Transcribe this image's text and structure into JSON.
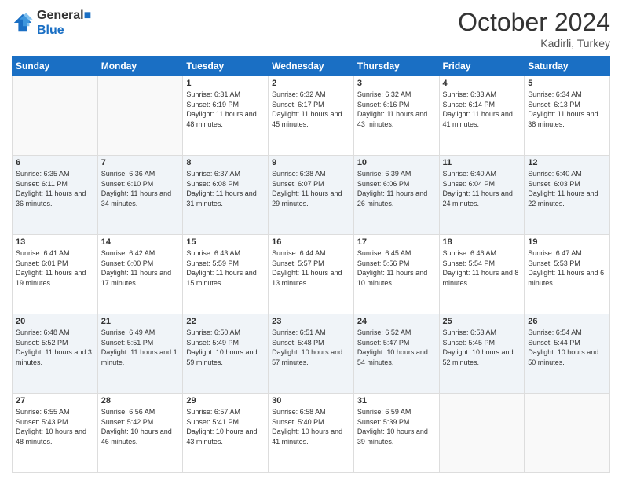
{
  "header": {
    "logo_line1": "General",
    "logo_line2": "Blue",
    "month": "October 2024",
    "location": "Kadirli, Turkey"
  },
  "weekdays": [
    "Sunday",
    "Monday",
    "Tuesday",
    "Wednesday",
    "Thursday",
    "Friday",
    "Saturday"
  ],
  "weeks": [
    [
      {
        "day": "",
        "sunrise": "",
        "sunset": "",
        "daylight": ""
      },
      {
        "day": "",
        "sunrise": "",
        "sunset": "",
        "daylight": ""
      },
      {
        "day": "1",
        "sunrise": "Sunrise: 6:31 AM",
        "sunset": "Sunset: 6:19 PM",
        "daylight": "Daylight: 11 hours and 48 minutes."
      },
      {
        "day": "2",
        "sunrise": "Sunrise: 6:32 AM",
        "sunset": "Sunset: 6:17 PM",
        "daylight": "Daylight: 11 hours and 45 minutes."
      },
      {
        "day": "3",
        "sunrise": "Sunrise: 6:32 AM",
        "sunset": "Sunset: 6:16 PM",
        "daylight": "Daylight: 11 hours and 43 minutes."
      },
      {
        "day": "4",
        "sunrise": "Sunrise: 6:33 AM",
        "sunset": "Sunset: 6:14 PM",
        "daylight": "Daylight: 11 hours and 41 minutes."
      },
      {
        "day": "5",
        "sunrise": "Sunrise: 6:34 AM",
        "sunset": "Sunset: 6:13 PM",
        "daylight": "Daylight: 11 hours and 38 minutes."
      }
    ],
    [
      {
        "day": "6",
        "sunrise": "Sunrise: 6:35 AM",
        "sunset": "Sunset: 6:11 PM",
        "daylight": "Daylight: 11 hours and 36 minutes."
      },
      {
        "day": "7",
        "sunrise": "Sunrise: 6:36 AM",
        "sunset": "Sunset: 6:10 PM",
        "daylight": "Daylight: 11 hours and 34 minutes."
      },
      {
        "day": "8",
        "sunrise": "Sunrise: 6:37 AM",
        "sunset": "Sunset: 6:08 PM",
        "daylight": "Daylight: 11 hours and 31 minutes."
      },
      {
        "day": "9",
        "sunrise": "Sunrise: 6:38 AM",
        "sunset": "Sunset: 6:07 PM",
        "daylight": "Daylight: 11 hours and 29 minutes."
      },
      {
        "day": "10",
        "sunrise": "Sunrise: 6:39 AM",
        "sunset": "Sunset: 6:06 PM",
        "daylight": "Daylight: 11 hours and 26 minutes."
      },
      {
        "day": "11",
        "sunrise": "Sunrise: 6:40 AM",
        "sunset": "Sunset: 6:04 PM",
        "daylight": "Daylight: 11 hours and 24 minutes."
      },
      {
        "day": "12",
        "sunrise": "Sunrise: 6:40 AM",
        "sunset": "Sunset: 6:03 PM",
        "daylight": "Daylight: 11 hours and 22 minutes."
      }
    ],
    [
      {
        "day": "13",
        "sunrise": "Sunrise: 6:41 AM",
        "sunset": "Sunset: 6:01 PM",
        "daylight": "Daylight: 11 hours and 19 minutes."
      },
      {
        "day": "14",
        "sunrise": "Sunrise: 6:42 AM",
        "sunset": "Sunset: 6:00 PM",
        "daylight": "Daylight: 11 hours and 17 minutes."
      },
      {
        "day": "15",
        "sunrise": "Sunrise: 6:43 AM",
        "sunset": "Sunset: 5:59 PM",
        "daylight": "Daylight: 11 hours and 15 minutes."
      },
      {
        "day": "16",
        "sunrise": "Sunrise: 6:44 AM",
        "sunset": "Sunset: 5:57 PM",
        "daylight": "Daylight: 11 hours and 13 minutes."
      },
      {
        "day": "17",
        "sunrise": "Sunrise: 6:45 AM",
        "sunset": "Sunset: 5:56 PM",
        "daylight": "Daylight: 11 hours and 10 minutes."
      },
      {
        "day": "18",
        "sunrise": "Sunrise: 6:46 AM",
        "sunset": "Sunset: 5:54 PM",
        "daylight": "Daylight: 11 hours and 8 minutes."
      },
      {
        "day": "19",
        "sunrise": "Sunrise: 6:47 AM",
        "sunset": "Sunset: 5:53 PM",
        "daylight": "Daylight: 11 hours and 6 minutes."
      }
    ],
    [
      {
        "day": "20",
        "sunrise": "Sunrise: 6:48 AM",
        "sunset": "Sunset: 5:52 PM",
        "daylight": "Daylight: 11 hours and 3 minutes."
      },
      {
        "day": "21",
        "sunrise": "Sunrise: 6:49 AM",
        "sunset": "Sunset: 5:51 PM",
        "daylight": "Daylight: 11 hours and 1 minute."
      },
      {
        "day": "22",
        "sunrise": "Sunrise: 6:50 AM",
        "sunset": "Sunset: 5:49 PM",
        "daylight": "Daylight: 10 hours and 59 minutes."
      },
      {
        "day": "23",
        "sunrise": "Sunrise: 6:51 AM",
        "sunset": "Sunset: 5:48 PM",
        "daylight": "Daylight: 10 hours and 57 minutes."
      },
      {
        "day": "24",
        "sunrise": "Sunrise: 6:52 AM",
        "sunset": "Sunset: 5:47 PM",
        "daylight": "Daylight: 10 hours and 54 minutes."
      },
      {
        "day": "25",
        "sunrise": "Sunrise: 6:53 AM",
        "sunset": "Sunset: 5:45 PM",
        "daylight": "Daylight: 10 hours and 52 minutes."
      },
      {
        "day": "26",
        "sunrise": "Sunrise: 6:54 AM",
        "sunset": "Sunset: 5:44 PM",
        "daylight": "Daylight: 10 hours and 50 minutes."
      }
    ],
    [
      {
        "day": "27",
        "sunrise": "Sunrise: 6:55 AM",
        "sunset": "Sunset: 5:43 PM",
        "daylight": "Daylight: 10 hours and 48 minutes."
      },
      {
        "day": "28",
        "sunrise": "Sunrise: 6:56 AM",
        "sunset": "Sunset: 5:42 PM",
        "daylight": "Daylight: 10 hours and 46 minutes."
      },
      {
        "day": "29",
        "sunrise": "Sunrise: 6:57 AM",
        "sunset": "Sunset: 5:41 PM",
        "daylight": "Daylight: 10 hours and 43 minutes."
      },
      {
        "day": "30",
        "sunrise": "Sunrise: 6:58 AM",
        "sunset": "Sunset: 5:40 PM",
        "daylight": "Daylight: 10 hours and 41 minutes."
      },
      {
        "day": "31",
        "sunrise": "Sunrise: 6:59 AM",
        "sunset": "Sunset: 5:39 PM",
        "daylight": "Daylight: 10 hours and 39 minutes."
      },
      {
        "day": "",
        "sunrise": "",
        "sunset": "",
        "daylight": ""
      },
      {
        "day": "",
        "sunrise": "",
        "sunset": "",
        "daylight": ""
      }
    ]
  ]
}
